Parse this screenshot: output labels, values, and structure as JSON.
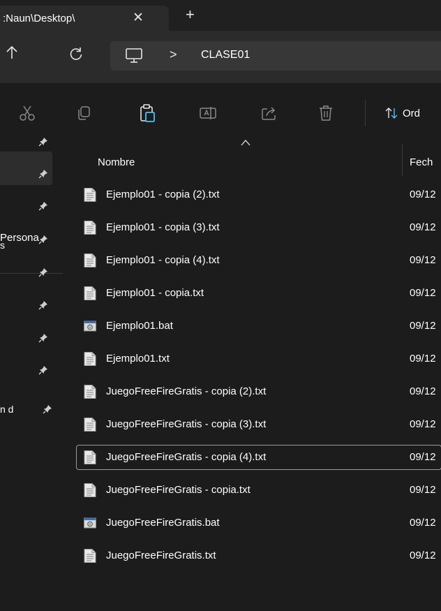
{
  "tab": {
    "title": ":Naun\\Desktop\\",
    "close_glyph": "✕",
    "new_tab_glyph": "+"
  },
  "address": {
    "separator": ">",
    "folder": "CLASE01",
    "icons": [
      "up-arrow-icon",
      "refresh-icon",
      "this-pc-icon"
    ]
  },
  "command_bar": {
    "icons": [
      "cut-icon",
      "copy-icon",
      "paste-icon",
      "rename-icon",
      "share-icon",
      "delete-icon"
    ],
    "sort_label": "Ord"
  },
  "sidebar": {
    "personal_label": "Persona",
    "entries": [
      {
        "label": ""
      },
      {
        "label": ""
      },
      {
        "label": ""
      },
      {
        "label": "s"
      },
      {
        "label": ""
      },
      {
        "label": ""
      },
      {
        "label": ""
      },
      {
        "label": ""
      },
      {
        "label": "n d"
      }
    ]
  },
  "columns": {
    "name": "Nombre",
    "date": "Fech"
  },
  "files": [
    {
      "name": "Ejemplo01 - copia (2).txt",
      "date": "09/12",
      "type": "txt"
    },
    {
      "name": "Ejemplo01 - copia (3).txt",
      "date": "09/12",
      "type": "txt"
    },
    {
      "name": "Ejemplo01 - copia (4).txt",
      "date": "09/12",
      "type": "txt"
    },
    {
      "name": "Ejemplo01 - copia.txt",
      "date": "09/12",
      "type": "txt"
    },
    {
      "name": "Ejemplo01.bat",
      "date": "09/12",
      "type": "bat"
    },
    {
      "name": "Ejemplo01.txt",
      "date": "09/12",
      "type": "txt"
    },
    {
      "name": "JuegoFreeFireGratis - copia (2).txt",
      "date": "09/12",
      "type": "txt"
    },
    {
      "name": "JuegoFreeFireGratis - copia (3).txt",
      "date": "09/12",
      "type": "txt"
    },
    {
      "name": "JuegoFreeFireGratis - copia (4).txt",
      "date": "09/12",
      "type": "txt",
      "focused": true
    },
    {
      "name": "JuegoFreeFireGratis - copia.txt",
      "date": "09/12",
      "type": "txt"
    },
    {
      "name": "JuegoFreeFireGratis.bat",
      "date": "09/12",
      "type": "bat"
    },
    {
      "name": "JuegoFreeFireGratis.txt",
      "date": "09/12",
      "type": "txt"
    }
  ],
  "colors": {
    "background": "#1c1c1c",
    "titlebar": "#202020",
    "tab": "#2b2b2b",
    "address_bar": "#373737",
    "accent": "#4cc2ff",
    "focus_outline": "#9a9a9a"
  }
}
